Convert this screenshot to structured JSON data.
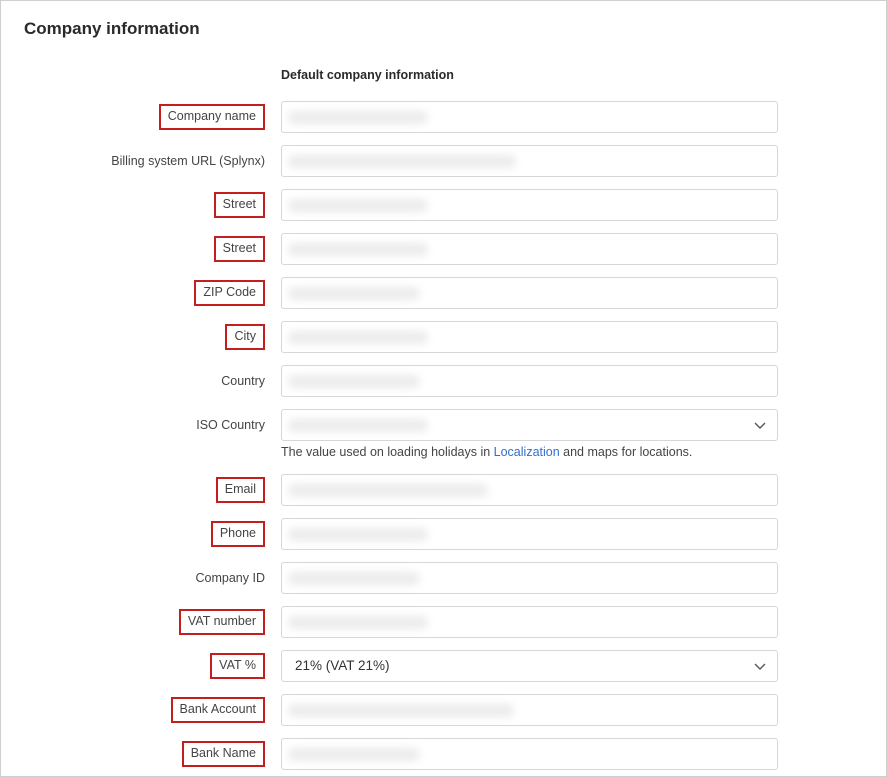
{
  "panel": {
    "title": "Company information"
  },
  "section": {
    "title": "Default company information"
  },
  "fields": {
    "company_name": {
      "label": "Company name",
      "value": ""
    },
    "billing_url": {
      "label": "Billing system URL (Splynx)",
      "value": ""
    },
    "street_1": {
      "label": "Street",
      "value": ""
    },
    "street_2": {
      "label": "Street",
      "value": ""
    },
    "zip": {
      "label": "ZIP Code",
      "value": ""
    },
    "city": {
      "label": "City",
      "value": ""
    },
    "country": {
      "label": "Country",
      "value": ""
    },
    "iso_country": {
      "label": "ISO Country",
      "value": ""
    },
    "email": {
      "label": "Email",
      "value": ""
    },
    "phone": {
      "label": "Phone",
      "value": ""
    },
    "company_id": {
      "label": "Company ID",
      "value": ""
    },
    "vat_number": {
      "label": "VAT number",
      "value": ""
    },
    "vat_percent": {
      "label": "VAT %",
      "value": "21% (VAT 21%)"
    },
    "bank_account": {
      "label": "Bank Account",
      "value": ""
    },
    "bank_name": {
      "label": "Bank Name",
      "value": ""
    }
  },
  "iso_hint": {
    "before": "The value used on loading holidays in ",
    "link": "Localization",
    "after": " and maps for locations."
  },
  "colors": {
    "highlight_border": "#c41e1e",
    "link": "#2f6fce",
    "field_border": "#d7d7d7"
  },
  "icons": {
    "select_arrow": "chevron-down-icon"
  }
}
